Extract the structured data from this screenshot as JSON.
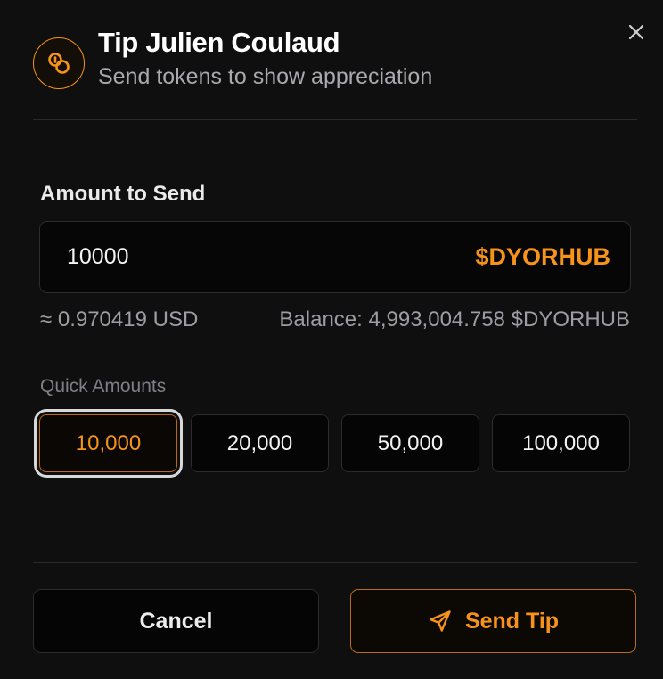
{
  "dialog": {
    "title": "Tip Julien Coulaud",
    "subtitle": "Send tokens to show appreciation",
    "icon": "coins-icon",
    "close_icon": "close-icon"
  },
  "amount": {
    "label": "Amount to Send",
    "value": "10000",
    "token": "$DYORHUB",
    "usd_estimate": "≈ 0.970419 USD",
    "balance": "Balance: 4,993,004.758 $DYORHUB"
  },
  "quick_amounts": {
    "label": "Quick Amounts",
    "options": [
      "10,000",
      "20,000",
      "50,000",
      "100,000"
    ],
    "selected": "10,000"
  },
  "footer": {
    "cancel_label": "Cancel",
    "send_label": "Send Tip",
    "send_icon": "send-icon"
  },
  "colors": {
    "accent": "#f7931a",
    "background": "#0f0f10",
    "border": "#2b2b30"
  }
}
